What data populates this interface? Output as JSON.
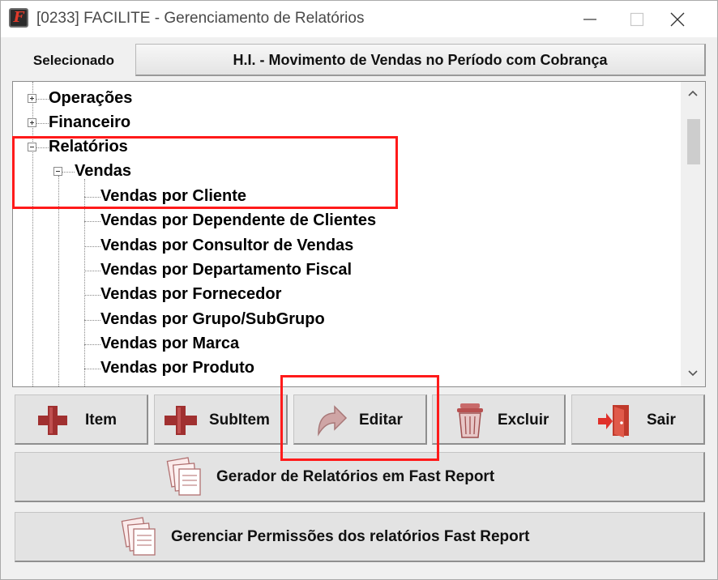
{
  "window": {
    "title": "[0233] FACILITE - Gerenciamento de Relatórios",
    "app_icon_letter": "F"
  },
  "selection": {
    "label": "Selecionado",
    "value": "H.I. - Movimento de Vendas no Período com Cobrança"
  },
  "tree": {
    "nodes": [
      {
        "label": "Operações",
        "state": "collapsed",
        "level": 0
      },
      {
        "label": "Financeiro",
        "state": "collapsed",
        "level": 0
      },
      {
        "label": "Relatórios",
        "state": "expanded",
        "level": 0
      },
      {
        "label": "Vendas",
        "state": "expanded",
        "level": 1
      },
      {
        "label": "Vendas por Cliente",
        "level": 2
      },
      {
        "label": "Vendas por Dependente de Clientes",
        "level": 2
      },
      {
        "label": "Vendas por Consultor de Vendas",
        "level": 2
      },
      {
        "label": "Vendas por Departamento Fiscal",
        "level": 2
      },
      {
        "label": "Vendas por Fornecedor",
        "level": 2
      },
      {
        "label": "Vendas por Grupo/SubGrupo",
        "level": 2
      },
      {
        "label": "Vendas por Marca",
        "level": 2
      },
      {
        "label": "Vendas por Produto",
        "level": 2
      }
    ]
  },
  "toolbar": {
    "item": "Item",
    "subitem": "SubItem",
    "editar": "Editar",
    "excluir": "Excluir",
    "sair": "Sair"
  },
  "actions": {
    "fast_report_generator": "Gerador de Relatórios em Fast Report",
    "fast_report_permissions": "Gerenciar Permissões dos relatórios Fast Report"
  },
  "colors": {
    "highlight_box": "#ff1a1a",
    "plus_icon": "#a03030",
    "window_bg": "#f0f0f0"
  }
}
